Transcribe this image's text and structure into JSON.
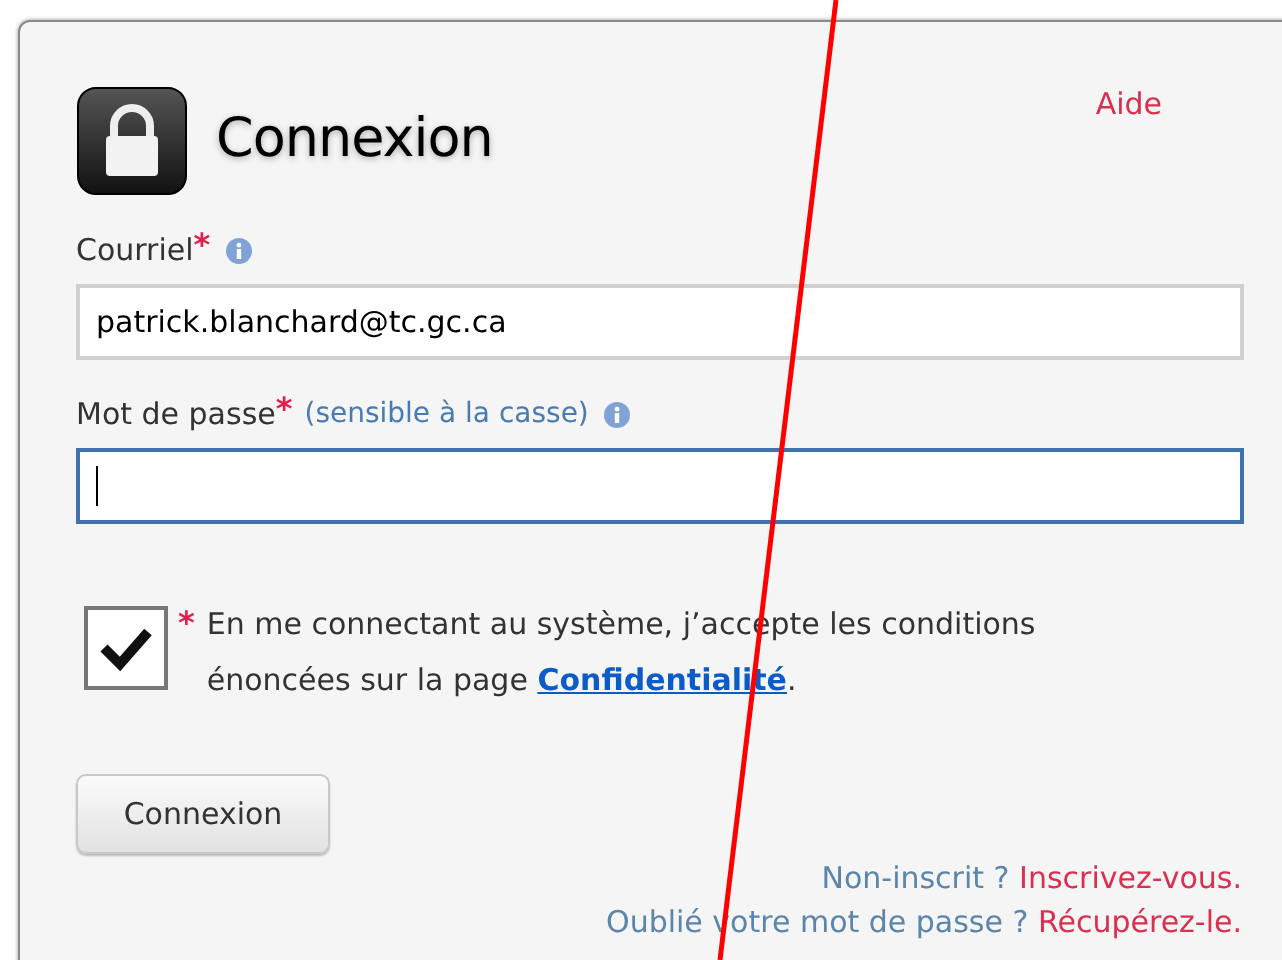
{
  "header": {
    "title": "Connexion",
    "help_link": "Aide"
  },
  "fields": [
    {
      "label": "Courriel",
      "required_mark": "*",
      "info": true,
      "value": "patrick.blanchard@tc.gc.ca",
      "focused": false
    },
    {
      "label": "Mot de passe",
      "required_mark": "*",
      "hint": "(sensible à la casse)",
      "info": true,
      "focused": true
    }
  ],
  "agreement": {
    "checked": true,
    "required_mark": "*",
    "text": "En me connectant au système, j’accepte les conditions énoncées sur la page",
    "link": "Confidentialité",
    "after": "."
  },
  "submit_button": "Connexion",
  "footer_links": [
    {
      "question": "Non-inscrit ?",
      "link": "Inscrivez-vous."
    },
    {
      "question": "Oublié votre mot de passe ?",
      "link": "Récupérez-le."
    }
  ]
}
